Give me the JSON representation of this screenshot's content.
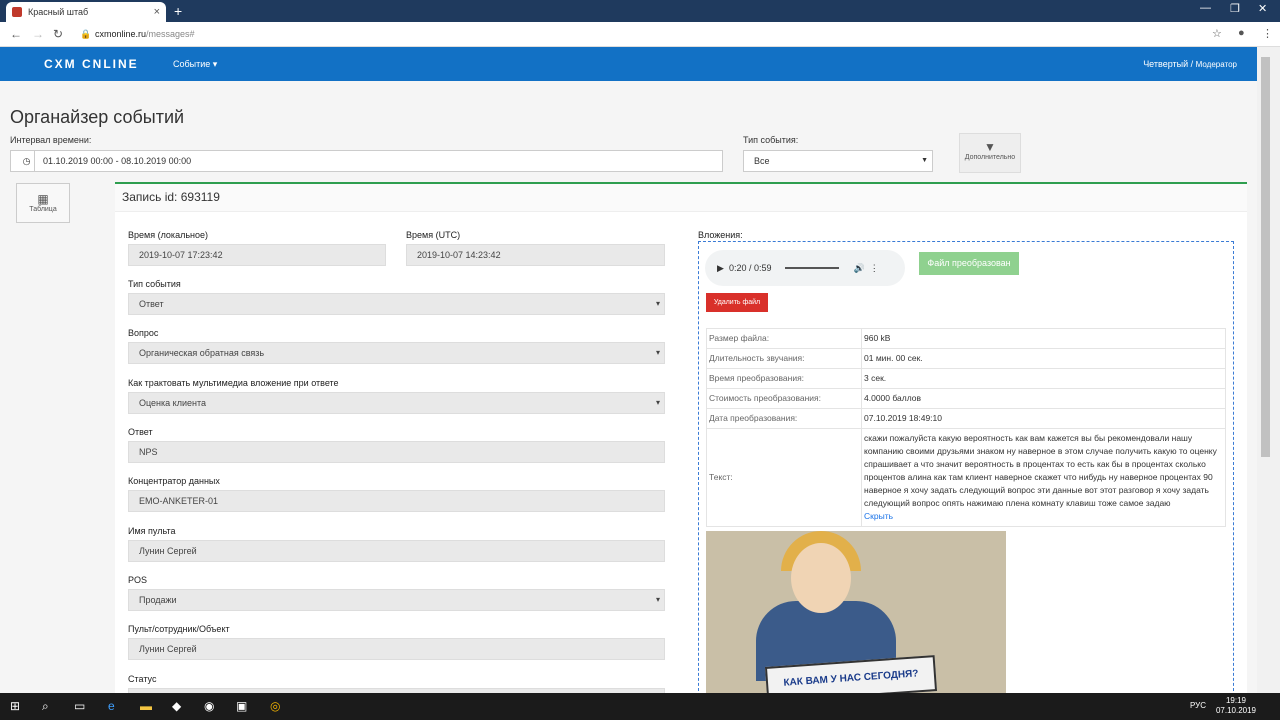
{
  "browser": {
    "tab_title": "Красный штаб",
    "tab_close": "×",
    "new_tab": "+",
    "url_host": "cxmonline.ru",
    "url_path": "/messages#",
    "win_min": "—",
    "win_max": "❐",
    "win_close": "✕"
  },
  "nav": {
    "logo": "CXM CNLINE",
    "menu": "Событие ▾",
    "user": "Четвертый /",
    "role": "Модератор"
  },
  "page": {
    "title": "Органайзер событий",
    "interval_label": "Интервал времени:",
    "interval_value": "01.10.2019 00:00 - 08.10.2019 00:00",
    "type_label": "Тип события:",
    "type_value": "Все",
    "filter_label": "Дополнительно",
    "table_btn_label": "Таблица"
  },
  "record": {
    "header": "Запись id: 693119",
    "local_time_label": "Время (локальное)",
    "local_time": "2019-10-07 17:23:42",
    "utc_time_label": "Время (UTC)",
    "utc_time": "2019-10-07 14:23:42",
    "event_type_label": "Тип события",
    "event_type": "Ответ",
    "question_label": "Вопрос",
    "question": "Органическая обратная связь",
    "multimedia_label": "Как трактовать мультимедиа вложение при ответе",
    "multimedia": "Оценка клиента",
    "answer_label": "Ответ",
    "answer": "NPS",
    "hub_label": "Концентратор данных",
    "hub": "EMO-ANKETER-01",
    "console_label": "Имя пульта",
    "console": "Лунин Сергей",
    "pos_label": "POS",
    "pos": "Продажи",
    "object_label": "Пульт/сотрудник/Объект",
    "object": "Лунин Сергей",
    "status_label": "Статус"
  },
  "attachments": {
    "label": "Вложения:",
    "audio_time": "0:20 / 0:59",
    "converted_btn": "Файл преобразован",
    "delete_btn": "Удалить файл",
    "rows": [
      {
        "k": "Размер файла:",
        "v": "960 kB"
      },
      {
        "k": "Длительность звучания:",
        "v": "01 мин. 00 сек."
      },
      {
        "k": "Время преобразования:",
        "v": "3 сек."
      },
      {
        "k": "Стоимость преобразования:",
        "v": "4.0000 баллов"
      },
      {
        "k": "Дата преобразования:",
        "v": "07.10.2019 18:49:10"
      }
    ],
    "text_label": "Текст:",
    "text": "скажи пожалуйста какую вероятность как вам кажется вы бы рекомендовали нашу компанию своими друзьями знаком ну наверное в этом случае получить какую то оценку спрашивает а что значит вероятность в процентах то есть как бы в процентах сколько процентов алина как там клиент наверное скажет что нибудь ну наверное процентах 90 наверное я хочу задать следующий вопрос эти данные вот этот разговор я хочу задать следующий вопрос опять нажимаю плена комнату клавиш тоже самое задаю",
    "hide_link": "Скрыть",
    "photo_sign": "КАК ВАМ У НАС СЕГОДНЯ?"
  },
  "taskbar": {
    "lang": "РУС",
    "time": "19:19",
    "date": "07.10.2019"
  }
}
